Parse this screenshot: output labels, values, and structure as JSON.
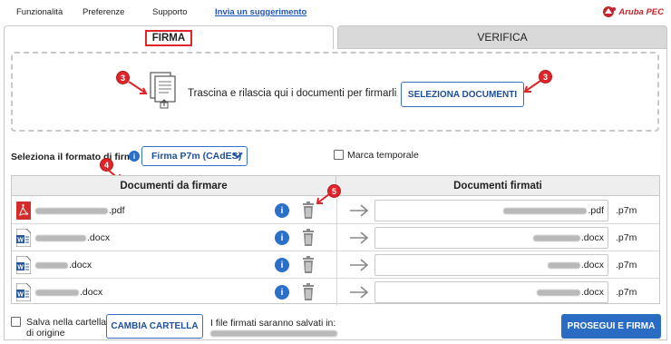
{
  "menu": {
    "items": [
      "Funzionalità",
      "Preferenze",
      "Supporto"
    ],
    "suggestion_link": "Invia un suggerimento"
  },
  "logo": {
    "text": "Aruba PEC"
  },
  "tabs": {
    "firma": "FIRMA",
    "verifica": "VERIFICA"
  },
  "dropzone": {
    "text": "Trascina e rilascia qui i documenti per firmarli",
    "button": "SELEZIONA DOCUMENTI"
  },
  "badges": {
    "doc_icon": "3",
    "select_button": "3",
    "documents_header": "4",
    "trash": "5"
  },
  "format": {
    "label": "Seleziona il formato di firma",
    "info_icon": "i",
    "selected": "Firma P7m (CAdES)",
    "timestamp_label": "Marca temporale"
  },
  "table": {
    "left_header": "Documenti da firmare",
    "right_header": "Documenti firmati",
    "info_icon": "i",
    "rows": [
      {
        "type": "pdf",
        "ext": ".pdf",
        "signed_ext": ".pdf",
        "suffix": ".p7m"
      },
      {
        "type": "docx",
        "ext": ".docx",
        "signed_ext": ".docx",
        "suffix": ".p7m"
      },
      {
        "type": "docx",
        "ext": ".docx",
        "signed_ext": ".docx",
        "suffix": ".p7m"
      },
      {
        "type": "docx",
        "ext": ".docx",
        "signed_ext": ".docx",
        "suffix": ".p7m"
      }
    ]
  },
  "footer": {
    "save_origin_label_1": "Salva nella cartella",
    "save_origin_label_2": "di origine",
    "change_folder_button": "CAMBIA CARTELLA",
    "save_info": "I file firmati saranno salvati in:",
    "proceed_button": "PROSEGUI E FIRMA"
  },
  "colors": {
    "accent": "#2a6cc4",
    "badge": "#e0252a",
    "pdf": "#d42b2b",
    "word": "#2b5797"
  }
}
